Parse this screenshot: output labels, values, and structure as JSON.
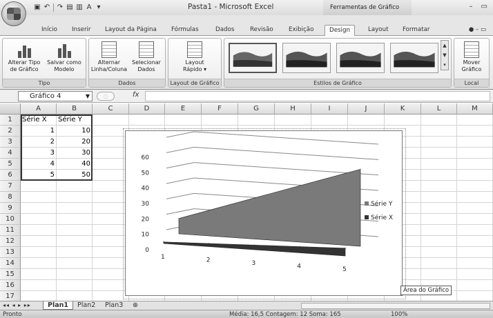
{
  "title_bar": {
    "title": "Pasta1 - Microsoft Excel",
    "context_title": "Ferramentas de Gráfico",
    "min_icon": "minimize-icon",
    "close_icon": "close-icon"
  },
  "tabs": [
    "Início",
    "Inserir",
    "Layout da Página",
    "Fórmulas",
    "Dados",
    "Revisão",
    "Exibição",
    "Design",
    "Layout",
    "Formatar"
  ],
  "active_tab": "Design",
  "ribbon": {
    "groups": {
      "tipo": "Tipo",
      "dados": "Dados",
      "layout": "Layout de Gráfico",
      "estilos": "Estilos de Gráfico",
      "local": "Local"
    },
    "buttons": {
      "alterar_tipo": "Alterar Tipo de Gráfico",
      "salvar_modelo": "Salvar como Modelo",
      "alternar": "Alternar Linha/Coluna",
      "selecionar": "Selecionar Dados",
      "layout_rapido": "Layout Rápido ▾",
      "mover": "Mover Gráfico"
    }
  },
  "formula_bar": {
    "name_box": "Gráfico 4",
    "fx_label": "fx"
  },
  "columns": [
    "A",
    "B",
    "C",
    "D",
    "E",
    "F",
    "G",
    "H",
    "I",
    "J",
    "K",
    "L",
    "M"
  ],
  "rows": [
    "1",
    "2",
    "3",
    "4",
    "5",
    "6",
    "7",
    "8",
    "9",
    "10",
    "11",
    "12",
    "13",
    "14",
    "15",
    "16",
    "17"
  ],
  "table": {
    "headers": [
      "Série X",
      "Série Y"
    ],
    "data": [
      [
        "1",
        "10"
      ],
      [
        "2",
        "20"
      ],
      [
        "3",
        "30"
      ],
      [
        "4",
        "40"
      ],
      [
        "5",
        "50"
      ]
    ]
  },
  "chart_data": {
    "type": "area",
    "x": [
      1,
      2,
      3,
      4,
      5
    ],
    "series": [
      {
        "name": "Série Y",
        "values": [
          10,
          20,
          30,
          40,
          50
        ],
        "color": "#7a7a7a"
      },
      {
        "name": "Série X",
        "values": [
          1,
          2,
          3,
          4,
          5
        ],
        "color": "#333333"
      }
    ],
    "y_ticks": [
      0,
      10,
      20,
      30,
      40,
      50,
      60
    ],
    "x_ticks": [
      1,
      2,
      3,
      4,
      5
    ],
    "ylim": [
      0,
      60
    ],
    "grid": true,
    "legend": "right",
    "three_d": true
  },
  "chart_tooltip": "Área do Gráfico",
  "sheets": [
    "Plan1",
    "Plan2",
    "Plan3"
  ],
  "active_sheet": "Plan1",
  "status": {
    "ready": "Pronto",
    "stats": "Média: 16,5    Contagem: 12    Soma: 165",
    "zoom": "100%"
  }
}
